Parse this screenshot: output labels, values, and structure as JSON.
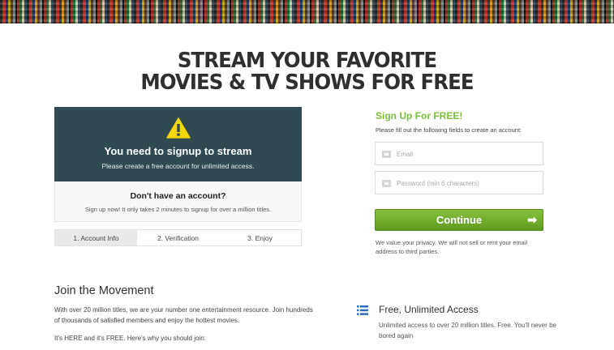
{
  "headline": {
    "line1": "STREAM YOUR FAVORITE",
    "line2": "MOVIES & TV SHOWS FOR FREE"
  },
  "notice": {
    "icon": "warning-icon",
    "title": "You need to signup to stream",
    "subtitle": "Please create a free account for unlimited access."
  },
  "account": {
    "title": "Don't have an account?",
    "subtitle": "Sign up now! It only takes 2 minutes to signup for over a million titles."
  },
  "steps": [
    {
      "label": "1. Account Info"
    },
    {
      "label": "2. Verification"
    },
    {
      "label": "3. Enjoy"
    }
  ],
  "signup": {
    "title": "Sign Up For FREE!",
    "subtitle": "Please fill out the following fields to create an account:",
    "email_placeholder": "Email",
    "email_value": "",
    "password_placeholder": "Password (min 6 characters)",
    "password_value": "",
    "continue_label": "Continue",
    "continue_arrow": "➡",
    "privacy": "We value your privacy. We will not sell or rent your email address to third parties."
  },
  "join": {
    "title": "Join the Movement",
    "text": "With over 20 million titles, we are your number one entertainment resource. Join hundreds of thousands of satisfied members and enjoy the hottest movies.",
    "text2": "It's HERE and it's FREE. Here's why you should join:"
  },
  "feature": {
    "icon": "list-icon",
    "title": "Free, Unlimited Access",
    "text": "Unlimited access to over 20 million titles. Free. You'll never be bored again"
  },
  "colors": {
    "notice_bg": "#2f4a50",
    "accent_green": "#7cbf3a",
    "button_green": "#6ea92a",
    "icon_blue": "#2d6fb8",
    "warning_yellow": "#f5d60c"
  }
}
